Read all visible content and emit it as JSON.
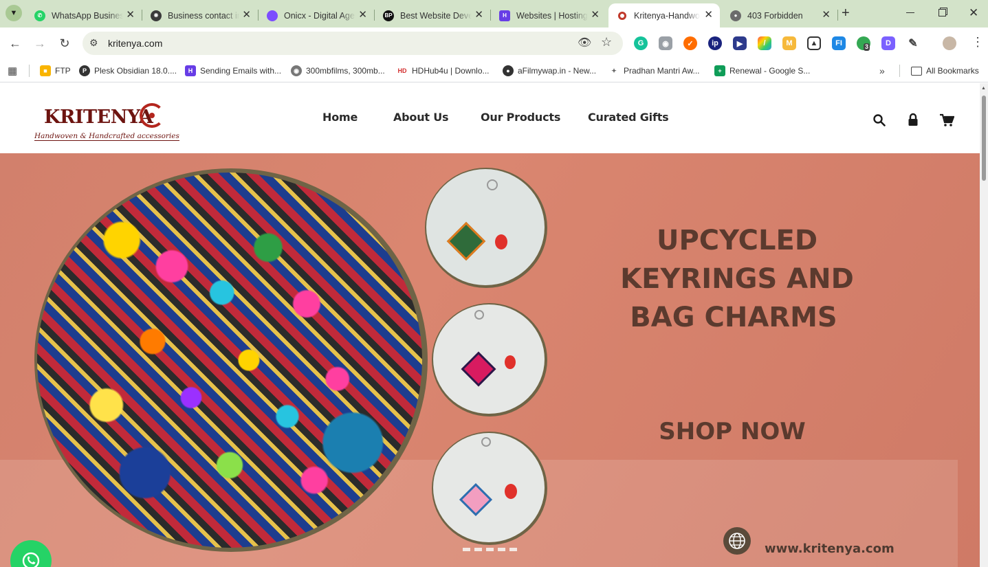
{
  "browser": {
    "tabs": [
      {
        "title": "WhatsApp Business",
        "active": false
      },
      {
        "title": "Business contact information",
        "active": false
      },
      {
        "title": "Onicx - Digital Agency",
        "active": false
      },
      {
        "title": "Best Website Development",
        "active": false
      },
      {
        "title": "Websites | Hosting",
        "active": false
      },
      {
        "title": "Kritenya-Handwoven",
        "active": true
      },
      {
        "title": "403 Forbidden",
        "active": false
      }
    ],
    "url": "kritenya.com",
    "ext_badge": "3",
    "bookmarks": [
      {
        "label": "FTP"
      },
      {
        "label": "Plesk Obsidian 18.0...."
      },
      {
        "label": "Sending Emails with..."
      },
      {
        "label": "300mbfilms, 300mb..."
      },
      {
        "label": "HDHub4u | Downlo..."
      },
      {
        "label": "aFilmywap.in - New..."
      },
      {
        "label": "Pradhan Mantri Aw..."
      },
      {
        "label": "Renewal - Google S..."
      }
    ],
    "all_bookmarks": "All Bookmarks"
  },
  "site": {
    "logo_text": "KRITENYA",
    "logo_tagline": "Handwoven & Handcrafted accessories",
    "nav": [
      "Home",
      "About Us",
      "Our Products",
      "Curated Gifts"
    ],
    "hero": {
      "headline_1": "UPCYCLED",
      "headline_2": "KEYRINGS AND",
      "headline_3": "BAG CHARMS",
      "cta": "SHOP NOW",
      "website": "www.kritenya.com"
    },
    "colors": {
      "hero_bg": "#d8836d",
      "text_brown": "#5b3a2e",
      "logo_red": "#b3261e",
      "whatsapp": "#25d366"
    }
  }
}
